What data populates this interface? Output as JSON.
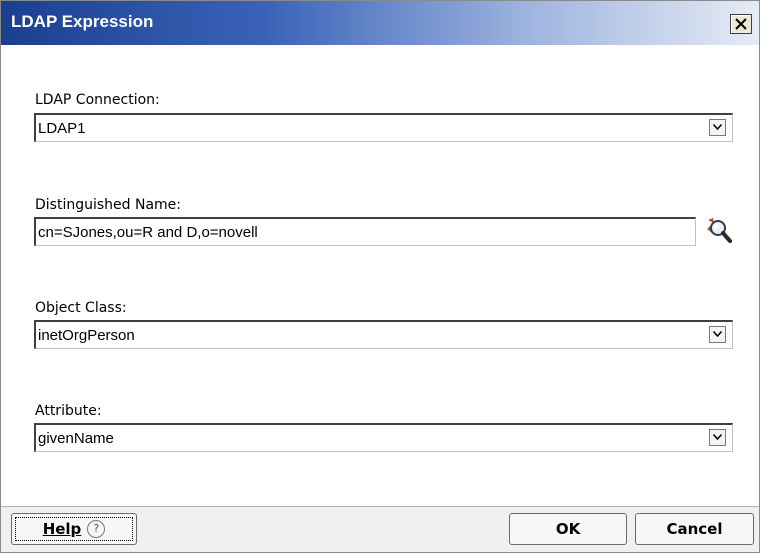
{
  "window": {
    "title": "LDAP Expression",
    "close_icon": "close-icon"
  },
  "fields": {
    "connection": {
      "label": "LDAP Connection:",
      "value": "LDAP1"
    },
    "dn": {
      "label": "Distinguished Name:",
      "value": "cn=SJones,ou=R and D,o=novell",
      "browse_icon": "browse-search-icon"
    },
    "object_class": {
      "label": "Object Class:",
      "value": "inetOrgPerson"
    },
    "attribute": {
      "label": "Attribute:",
      "value": "givenName"
    }
  },
  "buttons": {
    "help": "Help",
    "help_glyph": "?",
    "ok": "OK",
    "cancel": "Cancel"
  }
}
